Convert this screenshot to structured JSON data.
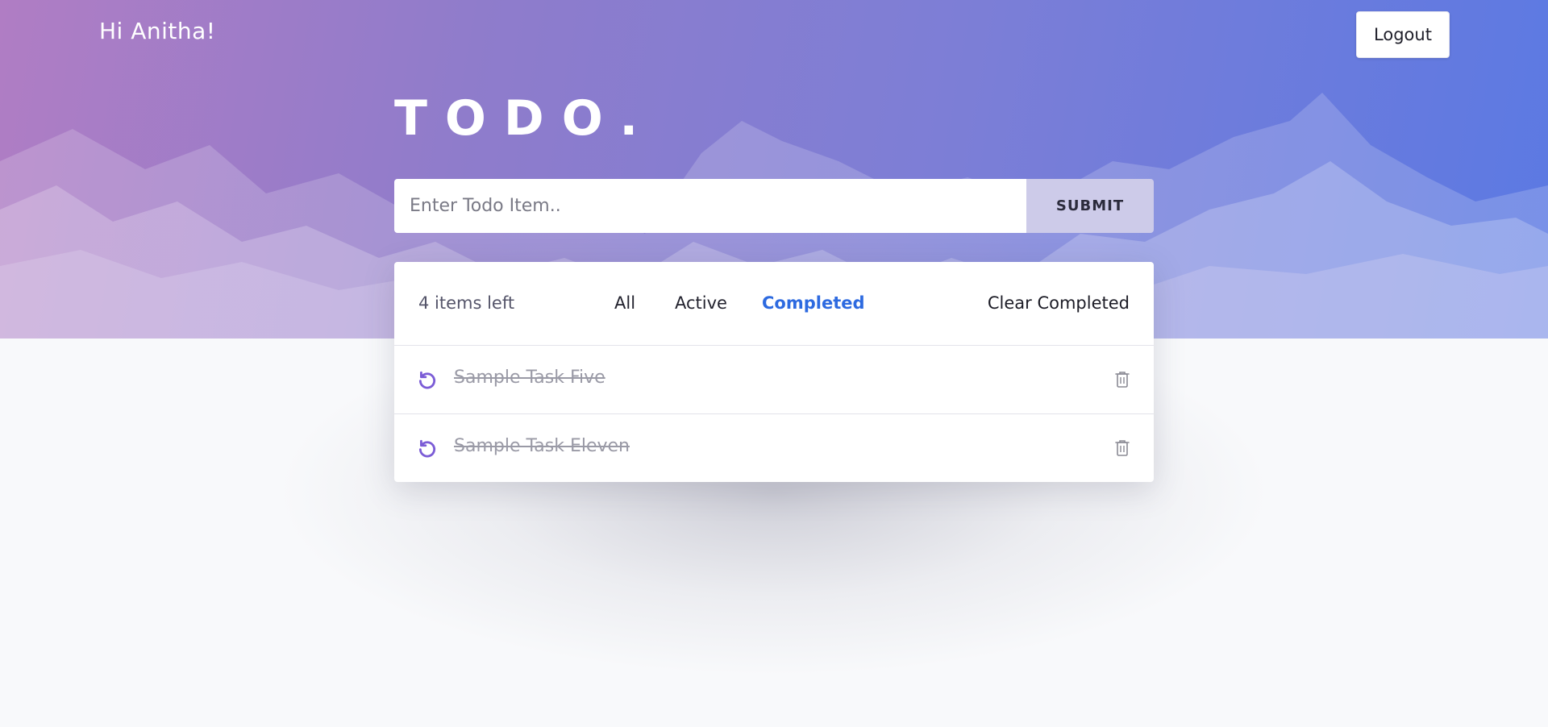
{
  "header": {
    "greeting": "Hi Anitha!",
    "logout_label": "Logout"
  },
  "app": {
    "title": "TODO."
  },
  "entry": {
    "placeholder": "Enter Todo Item..",
    "value": "",
    "submit_label": "SUBMIT"
  },
  "list": {
    "items_left": "4 items left",
    "filters": [
      {
        "label": "All",
        "selected": false
      },
      {
        "label": "Active",
        "selected": false
      },
      {
        "label": "Completed",
        "selected": true
      }
    ],
    "clear_completed_label": "Clear Completed",
    "todos": [
      {
        "text": "Sample Task Five",
        "completed": true,
        "icon": "undo-icon",
        "action_icon": "trash-icon"
      },
      {
        "text": "Sample Task Eleven",
        "completed": true,
        "icon": "undo-icon",
        "action_icon": "trash-icon"
      }
    ]
  },
  "colors": {
    "accent": "#2d6ae0",
    "undo_icon": "#7b5cd6",
    "hero_gradient_start": "#b07dc4",
    "hero_gradient_end": "#5b79e3"
  }
}
